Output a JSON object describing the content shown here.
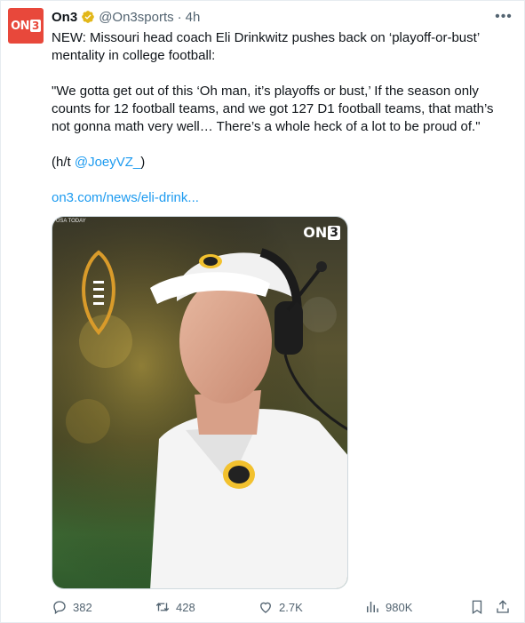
{
  "author": {
    "display_name": "On3",
    "handle": "@On3sports",
    "separator": "·",
    "time": "4h",
    "avatar_text": "ON",
    "avatar_number": "3",
    "verified_color": "#e2b719"
  },
  "tweet": {
    "line1": "NEW: Missouri head coach Eli Drinkwitz pushes back on ‘playoff-or-bust’ mentality in college football:",
    "quote": "\"We gotta get out of this ‘Oh man, it’s playoffs or bust,’ If the season only counts for 12 football teams, and we got 127 D1 football teams, that math’s not gonna math very well… There’s a whole heck of a lot to be proud of.\"",
    "credit_prefix": "(h/t ",
    "credit_handle": "@JoeyVZ_",
    "credit_suffix": ")",
    "link": "on3.com/news/eli-drink..."
  },
  "media": {
    "source_tag": "USA TODAY",
    "brand_text": "ON",
    "brand_number": "3"
  },
  "actions": {
    "replies": "382",
    "retweets": "428",
    "likes": "2.7K",
    "views": "980K"
  },
  "colors": {
    "accent": "#1d9bf0",
    "brand": "#e8483b",
    "muted": "#536471"
  }
}
